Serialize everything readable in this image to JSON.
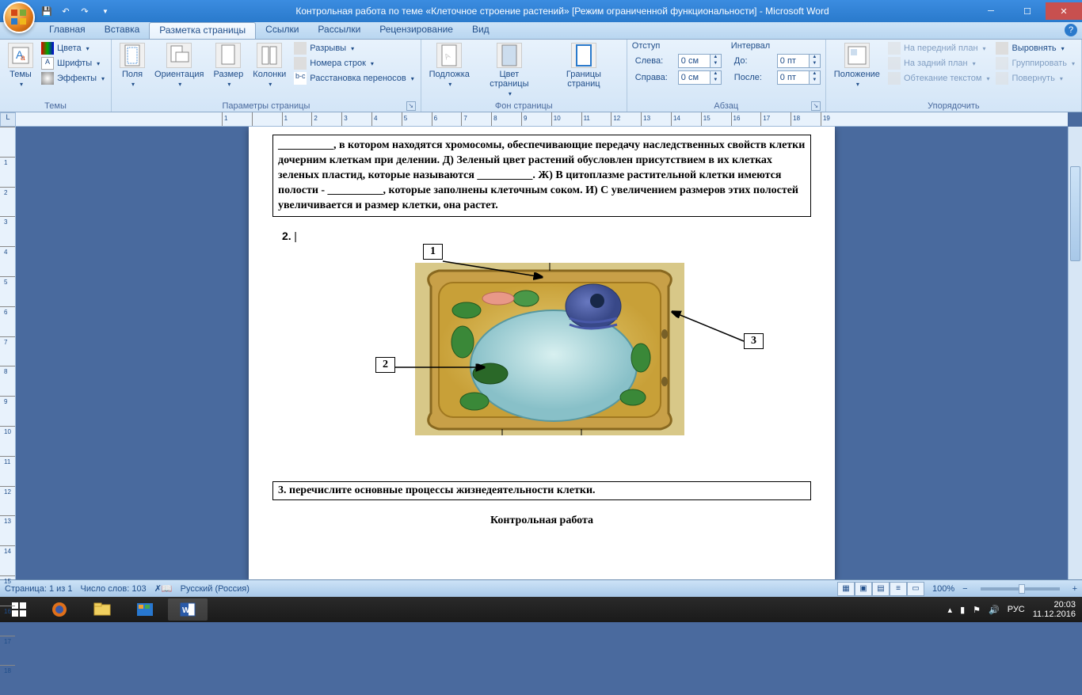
{
  "title": "Контрольная работа по теме «Клеточное строение растений» [Режим ограниченной функциональности] - Microsoft Word",
  "qat": {
    "save": "💾",
    "undo": "↶",
    "redo": "↷"
  },
  "tabs": [
    "Главная",
    "Вставка",
    "Разметка страницы",
    "Ссылки",
    "Рассылки",
    "Рецензирование",
    "Вид"
  ],
  "active_tab": 2,
  "ribbon": {
    "themes": {
      "label": "Темы",
      "main": "Темы",
      "colors": "Цвета",
      "fonts": "Шрифты",
      "effects": "Эффекты"
    },
    "page_setup": {
      "label": "Параметры страницы",
      "margins": "Поля",
      "orientation": "Ориентация",
      "size": "Размер",
      "columns": "Колонки",
      "breaks": "Разрывы",
      "line_numbers": "Номера строк",
      "hyphenation": "Расстановка переносов"
    },
    "page_bg": {
      "label": "Фон страницы",
      "watermark": "Подложка",
      "page_color": "Цвет страницы",
      "borders": "Границы страниц"
    },
    "paragraph": {
      "label": "Абзац",
      "indent_header": "Отступ",
      "left": "Слева:",
      "right": "Справа:",
      "left_val": "0 см",
      "right_val": "0 см",
      "spacing_header": "Интервал",
      "before": "До:",
      "after": "После:",
      "before_val": "0 пт",
      "after_val": "0 пт"
    },
    "arrange": {
      "label": "Упорядочить",
      "position": "Положение",
      "bring_front": "На передний план",
      "send_back": "На задний план",
      "text_wrap": "Обтекание текстом",
      "align": "Выровнять",
      "group": "Группировать",
      "rotate": "Повернуть"
    }
  },
  "document": {
    "para1": "__________, в котором находятся хромосомы, обеспечивающие передачу наследственных свойств клетки дочерним клеткам при делении. Д) Зеленый цвет растений обусловлен присутствием в их клетках зеленых пластид, которые называются __________. Ж) В цитоплазме растительной клетки имеются полости - __________, которые заполнены клеточным соком. И) С увеличением размеров этих полостей увеличивается и размер клетки, она растет.",
    "q2": "2.",
    "labels": {
      "l1": "1",
      "l2": "2",
      "l3": "3"
    },
    "q3": "3.  перечислите основные процессы жизнедеятельности клетки.",
    "footer": "Контрольная работа"
  },
  "status": {
    "page": "Страница: 1 из 1",
    "words": "Число слов: 103",
    "lang": "Русский (Россия)",
    "zoom": "100%"
  },
  "taskbar": {
    "lang": "РУС",
    "time": "20:03",
    "date": "11.12.2016"
  },
  "hruler_marks": [
    "1",
    "",
    "1",
    "2",
    "3",
    "4",
    "5",
    "6",
    "7",
    "8",
    "9",
    "10",
    "11",
    "12",
    "13",
    "14",
    "15",
    "16",
    "17",
    "18",
    "19"
  ],
  "vruler_marks": [
    "",
    "1",
    "2",
    "3",
    "4",
    "5",
    "6",
    "7",
    "8",
    "9",
    "10",
    "11",
    "12",
    "13",
    "14",
    "15",
    "16",
    "17",
    "18"
  ]
}
